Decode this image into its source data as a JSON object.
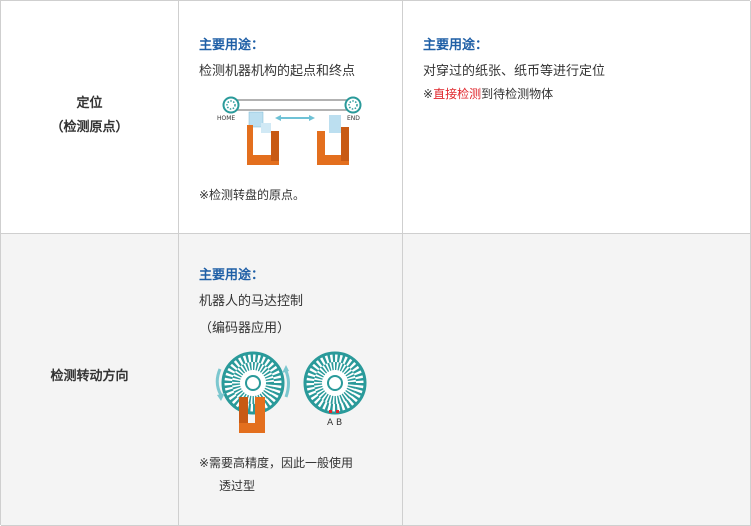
{
  "rows": [
    {
      "header_line1": "定位",
      "header_line2": "（检测原点）",
      "col2": {
        "use_title": "主要用途：",
        "description": "检测机器机构的起点和终点",
        "diagram_labels": {
          "home": "HOME",
          "end": "END"
        },
        "note": "※检测转盘的原点。"
      },
      "col3": {
        "use_title": "主要用途：",
        "description": "对穿过的纸张、纸币等进行定位",
        "note_prefix": "※",
        "note_highlight": "直接检测",
        "note_suffix": "到待检测物体"
      }
    },
    {
      "header": "检测转动方向",
      "col2": {
        "use_title": "主要用途：",
        "description_line1": "机器人的马达控制",
        "description_line2": "（编码器应用）",
        "diagram_label": "A B",
        "note_line1": "※需要高精度，因此一般使用",
        "note_line2": "透过型"
      }
    }
  ],
  "colors": {
    "title_blue": "#1f5fa6",
    "highlight_red": "#e0252b",
    "sensor_orange": "#e36f1e",
    "disk_teal": "#2a9a9a",
    "row2_bg": "#f4f4f4"
  }
}
